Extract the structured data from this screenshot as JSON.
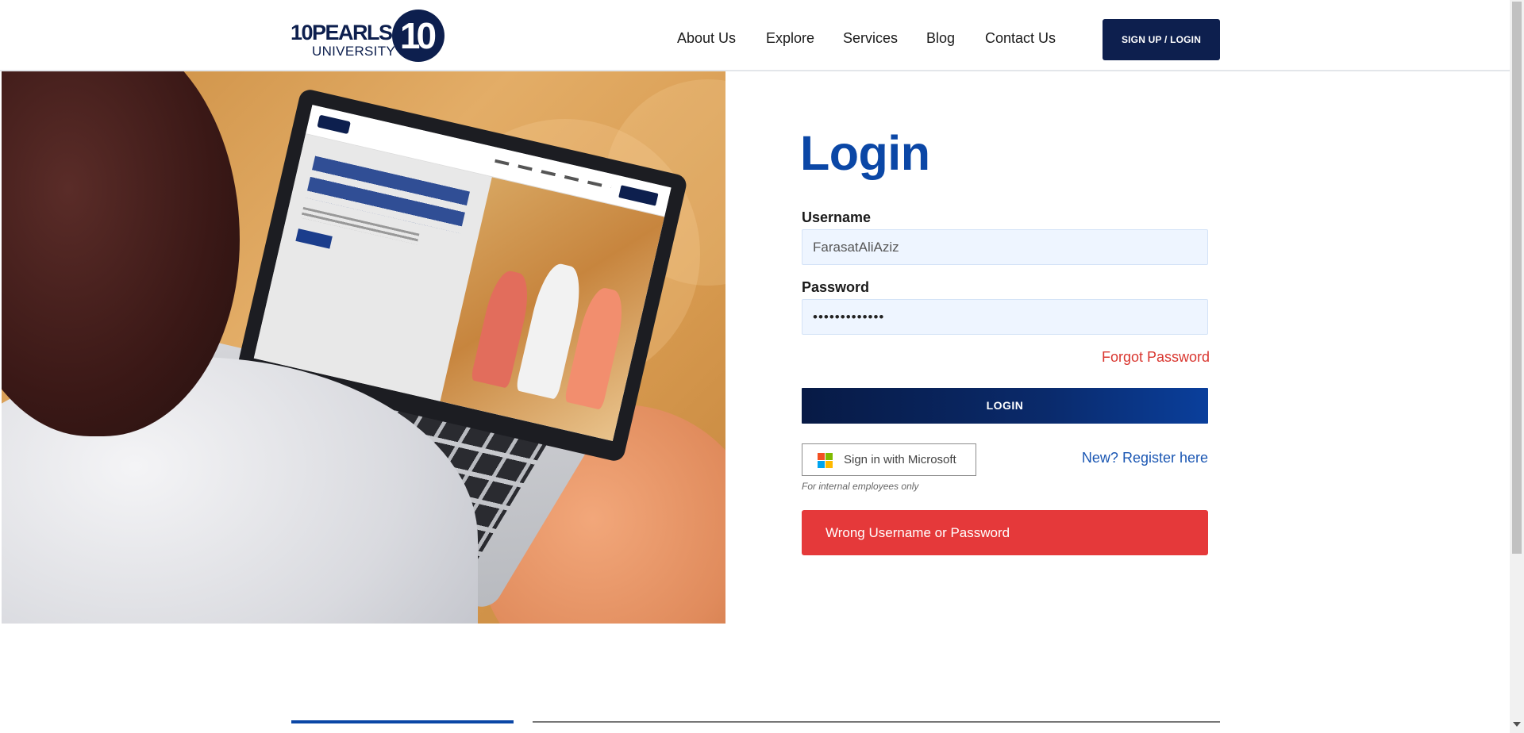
{
  "header": {
    "logo": {
      "line1": "10PEARLS",
      "line2": "UNIVERSITY",
      "mark": "10"
    },
    "nav": [
      {
        "label": "About Us"
      },
      {
        "label": "Explore"
      },
      {
        "label": "Services"
      },
      {
        "label": "Blog"
      },
      {
        "label": "Contact Us"
      }
    ],
    "signup_label": "SIGN UP / LOGIN"
  },
  "hero": {
    "icon": "laptop-user-photo"
  },
  "login": {
    "title": "Login",
    "username_label": "Username",
    "username_value": "FarasatAliAziz",
    "password_label": "Password",
    "password_value": "•••••••••••••",
    "forgot_label": "Forgot Password",
    "login_button": "LOGIN",
    "microsoft_button": "Sign in with Microsoft",
    "internal_note": "For internal employees only",
    "register_label": "New? Register here",
    "error_message": "Wrong Username or Password"
  },
  "colors": {
    "brand_navy": "#0d1f4e",
    "brand_blue": "#0b47a6",
    "error_red": "#e5393a",
    "link_red": "#d9362f",
    "field_bg": "#eef5ff"
  }
}
